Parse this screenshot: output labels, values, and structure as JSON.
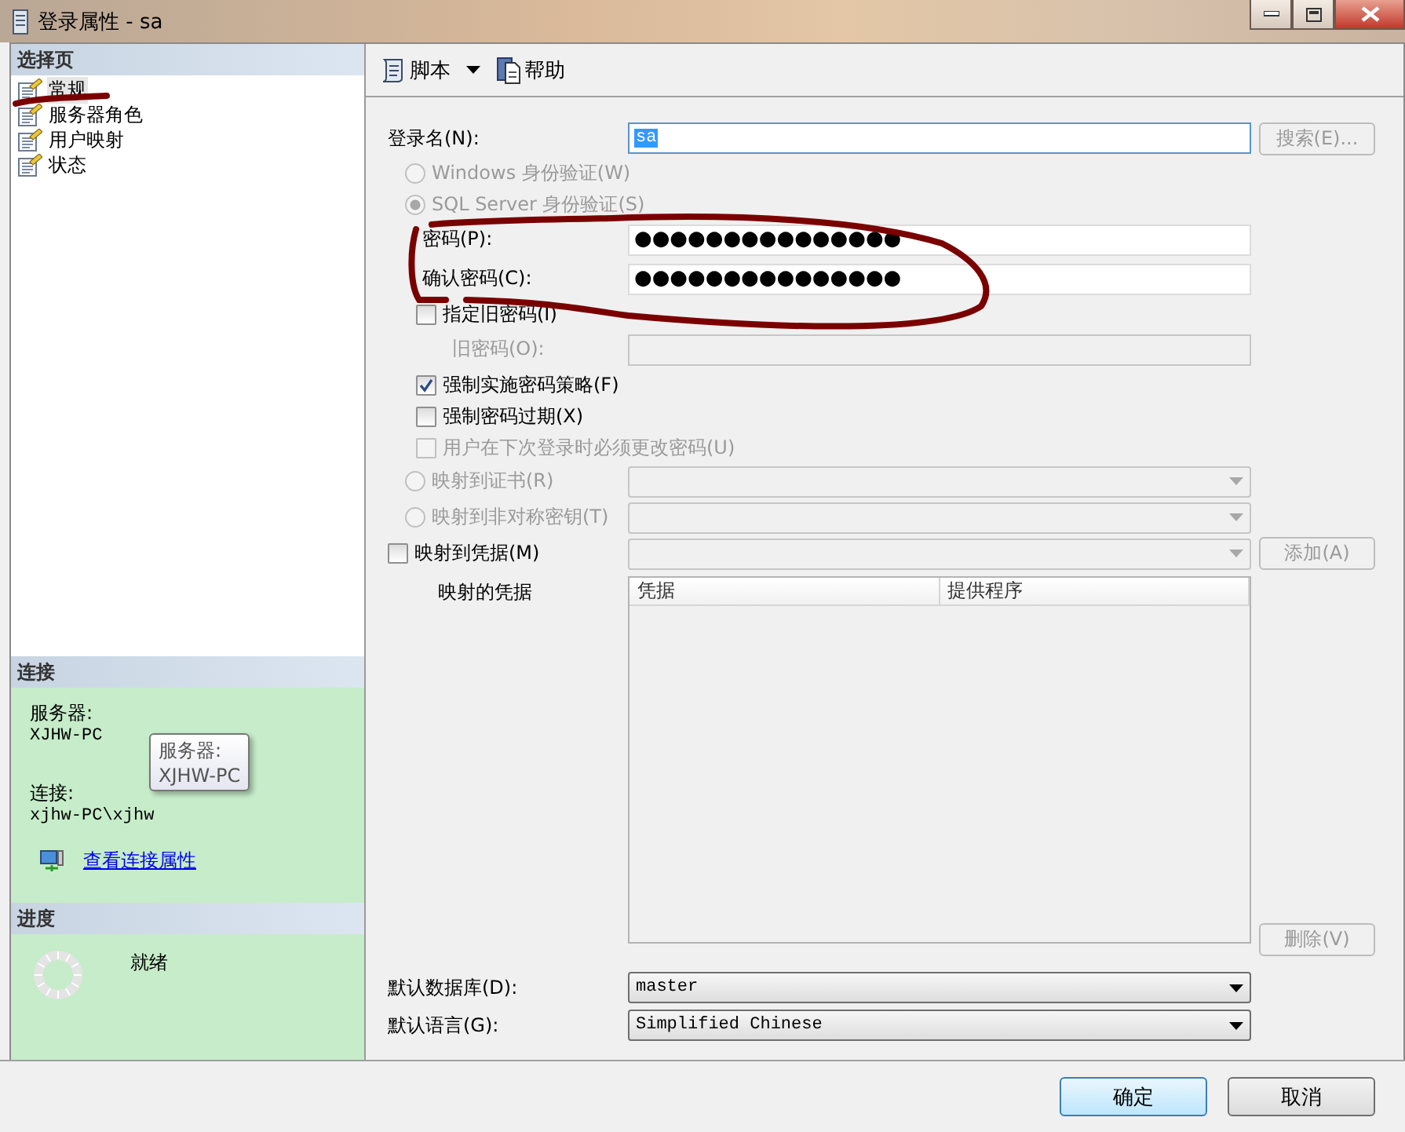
{
  "window": {
    "title": "登录属性 - sa"
  },
  "sidebar": {
    "header": "选择页",
    "items": [
      {
        "label": "常规",
        "selected": true
      },
      {
        "label": "服务器角色",
        "selected": false
      },
      {
        "label": "用户映射",
        "selected": false
      },
      {
        "label": "状态",
        "selected": false
      }
    ]
  },
  "connection": {
    "header": "连接",
    "server_label": "服务器:",
    "server": "XJHW-PC",
    "connection_label": "连接:",
    "connection": "xjhw-PC\\xjhw",
    "link": "查看连接属性",
    "tooltip": {
      "title": "服务器:",
      "value": "XJHW-PC"
    }
  },
  "progress": {
    "header": "进度",
    "status": "就绪"
  },
  "toolbar": {
    "script": "脚本",
    "help": "帮助"
  },
  "form": {
    "rows": [
      {
        "kind": "field",
        "label": "登录名(N):",
        "value": "sa",
        "text_selected": true,
        "focused": true,
        "button": {
          "label": "搜索(E)...",
          "disabled": true
        }
      },
      {
        "kind": "radio",
        "label": "Windows 身份验证(W)",
        "selected": false,
        "disabled": true
      },
      {
        "kind": "radio",
        "label": "SQL Server 身份验证(S)",
        "selected": true,
        "disabled": true,
        "children": [
          {
            "kind": "field",
            "label": "密码(P):",
            "value": "●●●●●●●●●●●●●●●"
          },
          {
            "kind": "field",
            "label": "确认密码(C):",
            "value": "●●●●●●●●●●●●●●●"
          },
          {
            "kind": "checkbox",
            "label": "指定旧密码(I)",
            "checked": false,
            "disabled": false,
            "children": [
              {
                "kind": "field",
                "label": "旧密码(O):",
                "disabled": true
              }
            ]
          },
          {
            "kind": "checkbox",
            "label": "强制实施密码策略(F)",
            "checked": true,
            "disabled": false
          },
          {
            "kind": "checkbox",
            "label": "强制密码过期(X)",
            "checked": false,
            "disabled": false
          },
          {
            "kind": "checkbox",
            "label": "用户在下次登录时必须更改密码(U)",
            "checked": false,
            "disabled": true
          }
        ]
      },
      {
        "kind": "radio",
        "label": "映射到证书(R)",
        "selected": false,
        "disabled": true,
        "select": {
          "disabled": true
        }
      },
      {
        "kind": "radio",
        "label": "映射到非对称密钥(T)",
        "selected": false,
        "disabled": true,
        "select": {
          "disabled": true
        }
      },
      {
        "kind": "checkbox",
        "label": "映射到凭据(M)",
        "checked": false,
        "disabled": false,
        "select": {
          "disabled": true
        },
        "button": {
          "label": "添加(A)",
          "disabled": true
        }
      },
      {
        "kind": "grid",
        "label": "映射的凭据",
        "columns": [
          "凭据",
          "提供程序"
        ],
        "button": {
          "label": "删除(V)",
          "disabled": true
        }
      },
      {
        "kind": "select",
        "label": "默认数据库(D):",
        "value": "master"
      },
      {
        "kind": "select",
        "label": "默认语言(G):",
        "value": "Simplified Chinese"
      }
    ]
  },
  "buttons": [
    {
      "label": "确定",
      "default": true
    },
    {
      "label": "取消",
      "default": false
    }
  ]
}
